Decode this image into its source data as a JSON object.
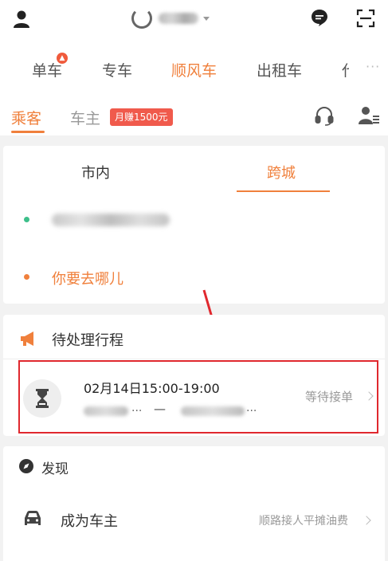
{
  "header": {
    "icons": [
      "user-icon",
      "didi-logo-icon",
      "message-icon",
      "scan-icon"
    ]
  },
  "service_tabs": [
    {
      "label": "单车",
      "active": false
    },
    {
      "label": "专车",
      "active": false
    },
    {
      "label": "顺风车",
      "active": true
    },
    {
      "label": "出租车",
      "active": false
    },
    {
      "label": "代",
      "active": false
    }
  ],
  "role_tabs": {
    "passenger": "乘客",
    "driver": "车主",
    "earn_badge": "月赚1500元"
  },
  "route_card": {
    "tab_city": "市内",
    "tab_intercity": "跨城",
    "active_tab": "跨城",
    "destination_placeholder": "你要去哪儿",
    "start_dot_color": "#3dbf8a",
    "end_dot_color": "#f0803c"
  },
  "pending": {
    "title": "待处理行程",
    "trip": {
      "time": "02月14日15:00-19:00",
      "from_ellipsis": "...",
      "to_ellipsis": "...",
      "status": "等待接单"
    }
  },
  "discover": {
    "title": "发现",
    "item_label": "成为车主",
    "item_desc": "顺路接人平摊油费"
  },
  "colors": {
    "accent": "#f0803c",
    "highlight": "#e0282e"
  }
}
